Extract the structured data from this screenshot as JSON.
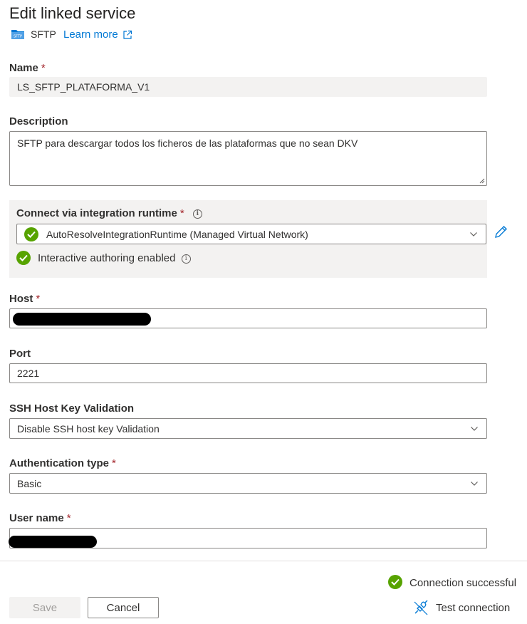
{
  "panel": {
    "title": "Edit linked service",
    "service_name": "SFTP",
    "icon_text": "SFTP",
    "learn_more": "Learn more"
  },
  "name": {
    "label": "Name",
    "required": "*",
    "value": "LS_SFTP_PLATAFORMA_V1"
  },
  "description": {
    "label": "Description",
    "value": "SFTP para descargar todos los ficheros de las plataformas que no sean DKV"
  },
  "integration_runtime": {
    "label": "Connect via integration runtime",
    "required": "*",
    "info": "i",
    "selected": "AutoResolveIntegrationRuntime (Managed Virtual Network)",
    "authoring_status": "Interactive authoring enabled",
    "authoring_info": "i"
  },
  "host": {
    "label": "Host",
    "required": "*"
  },
  "port": {
    "label": "Port",
    "value": "2221"
  },
  "ssh_host_key": {
    "label": "SSH Host Key Validation",
    "selected": "Disable SSH host key Validation"
  },
  "auth_type": {
    "label": "Authentication type",
    "required": "*",
    "selected": "Basic"
  },
  "user_name": {
    "label": "User name",
    "required": "*"
  },
  "footer": {
    "connection_status": "Connection successful",
    "test_connection": "Test connection",
    "save": "Save",
    "cancel": "Cancel"
  },
  "colors": {
    "accent": "#0078d4",
    "success": "#57a300",
    "required": "#a4262c",
    "disabled_bg": "#f3f2f1"
  }
}
